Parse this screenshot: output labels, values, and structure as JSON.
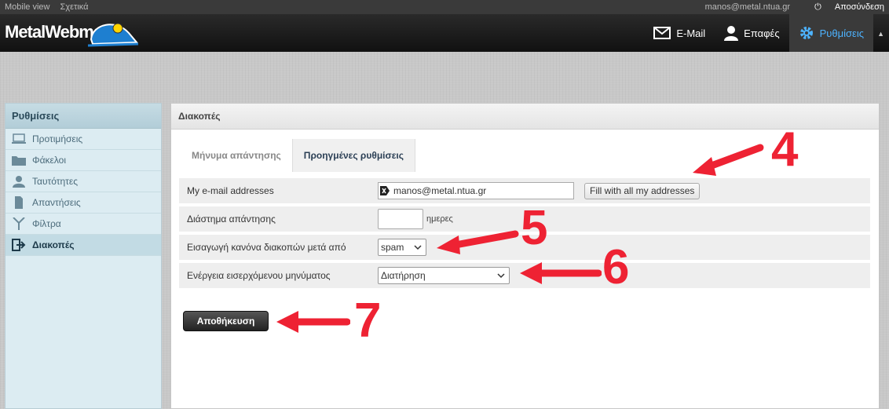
{
  "topbar": {
    "links": [
      "Mobile view",
      "Σχετικά"
    ],
    "user": "manos@metal.ntua.gr",
    "logout": "Αποσύνδεση"
  },
  "header": {
    "logo": "MetalWebmail",
    "nav": [
      {
        "label": "E-Mail",
        "icon": "envelope-icon"
      },
      {
        "label": "Επαφές",
        "icon": "person-icon"
      },
      {
        "label": "Ρυθμίσεις",
        "icon": "gear-icon",
        "active": true
      }
    ],
    "accent": "#4db3ff"
  },
  "sidebar": {
    "title": "Ρυθμίσεις",
    "items": [
      {
        "label": "Προτιμήσεις",
        "icon": "laptop-icon"
      },
      {
        "label": "Φάκελοι",
        "icon": "folder-icon"
      },
      {
        "label": "Ταυτότητες",
        "icon": "user-icon"
      },
      {
        "label": "Απαντήσεις",
        "icon": "document-icon"
      },
      {
        "label": "Φίλτρα",
        "icon": "filter-icon"
      },
      {
        "label": "Διακοπές",
        "icon": "exit-icon",
        "selected": true
      }
    ]
  },
  "panel": {
    "title": "Διακοπές",
    "tabs": [
      {
        "label": "Μήνυμα απάντησης"
      },
      {
        "label": "Προηγμένες ρυθμίσεις",
        "active": true
      }
    ],
    "rows": {
      "addresses_label": "My e-mail addresses",
      "address_value": "manos@metal.ntua.gr",
      "fill_button": "Fill with all my addresses",
      "interval_label": "Διάστημα απάντησης",
      "interval_value": "",
      "interval_unit": "ημερες",
      "insert_label": "Εισαγωγή κανόνα διακοπών μετά από",
      "insert_value": "spam",
      "action_label": "Ενέργεια εισερχόμενου μηνύματος",
      "action_value": "Διατήρηση"
    },
    "save_button": "Αποθήκευση"
  },
  "annotations": {
    "numbers": [
      "4",
      "5",
      "6",
      "7"
    ],
    "color": "#ee2233"
  }
}
